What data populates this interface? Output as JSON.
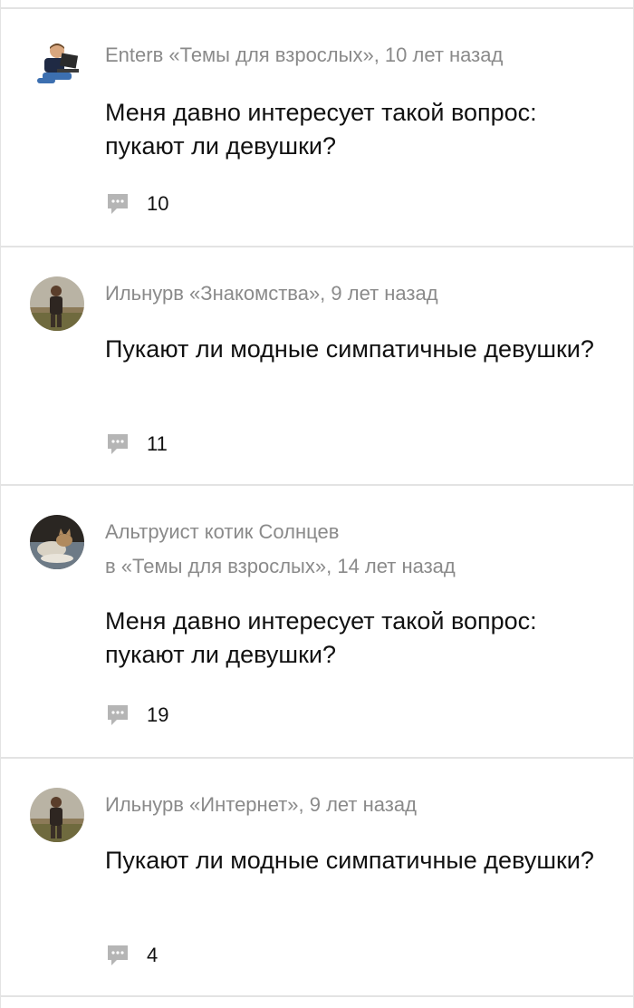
{
  "posts": [
    {
      "meta_lines": [
        "Enterв «Темы для взрослых», 10 лет назад"
      ],
      "question": "Меня давно интересует такой вопрос: пукают ли девушки?",
      "comment_count": "10",
      "avatar_icon": "boy-with-laptop-avatar"
    },
    {
      "meta_lines": [
        "Ильнурв «Знакомства», 9 лет назад"
      ],
      "question": "Пукают ли модные симпатичные девушки?",
      "comment_count": "11",
      "avatar_icon": "man-outdoors-avatar"
    },
    {
      "meta_lines": [
        "Альтруист котик Солнцев",
        "в «Темы для взрослых», 14 лет назад"
      ],
      "question": "Меня давно интересует такой вопрос: пукают ли девушки?",
      "comment_count": "19",
      "avatar_icon": "cat-avatar"
    },
    {
      "meta_lines": [
        "Ильнурв «Интернет», 9 лет назад"
      ],
      "question": "Пукают ли модные симпатичные девушки?",
      "comment_count": "4",
      "avatar_icon": "man-outdoors-avatar"
    }
  ],
  "colors": {
    "meta_text": "#8a8a8a",
    "body_text": "#111111",
    "divider": "#e3e3e3",
    "comment_icon": "#b5b5b5"
  },
  "comment_icon": "speech-bubble-icon"
}
